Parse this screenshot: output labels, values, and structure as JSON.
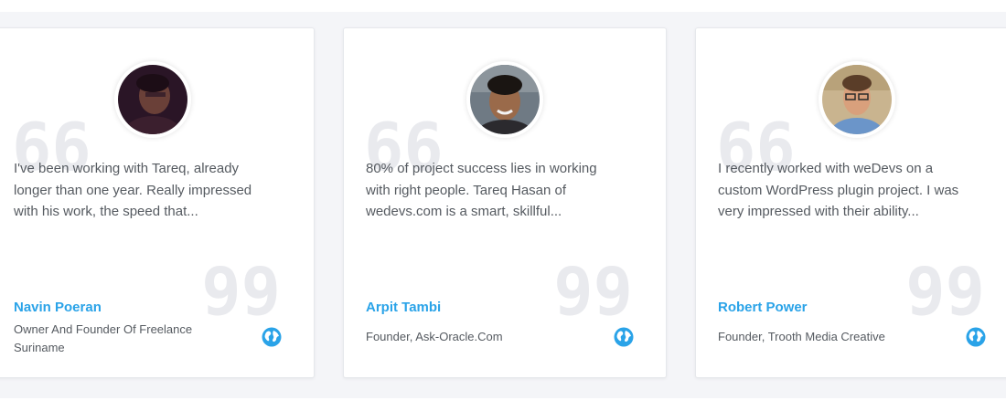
{
  "testimonials": [
    {
      "text": "I've been working with Tareq, already longer than one year. Really impressed with his work, the speed that...",
      "name": "Navin Poeran",
      "role": "Owner And Founder Of Freelance Suriname"
    },
    {
      "text": "80% of project success lies in working with right people. Tareq Hasan of wedevs.com is a smart, skillful...",
      "name": "Arpit Tambi",
      "role": "Founder, Ask-Oracle.Com"
    },
    {
      "text": "I recently worked with weDevs on a custom WordPress plugin project. I was very impressed with their ability...",
      "name": "Robert Power",
      "role": "Founder, Trooth Media Creative"
    }
  ],
  "colors": {
    "accent": "#2aa3e8",
    "text": "#555a60",
    "quote_mark": "#e9eaee",
    "background_band": "#f4f5f8"
  },
  "icons": {
    "quote_open": "quote-open-icon",
    "quote_close": "quote-close-icon",
    "website": "globe-icon"
  }
}
